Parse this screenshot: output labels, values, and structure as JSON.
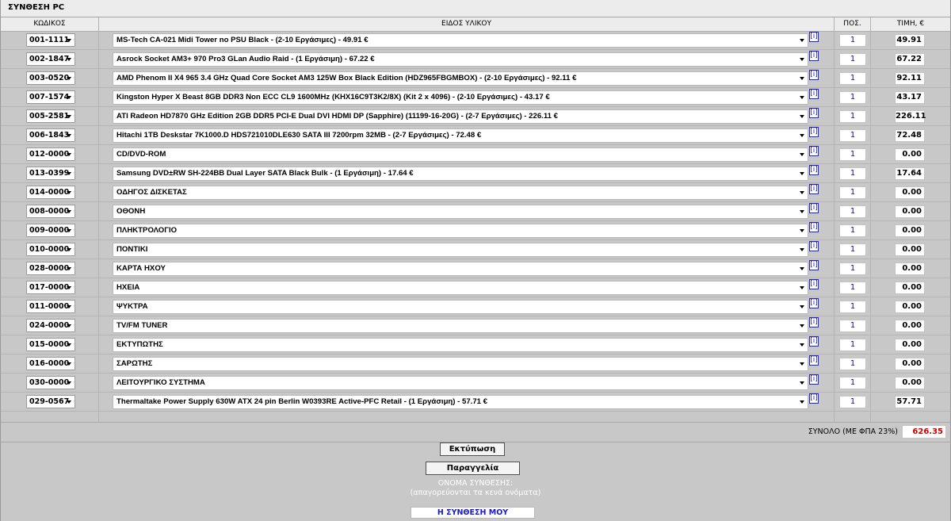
{
  "window": {
    "title": "ΣΥΝΘΕΣΗ PC"
  },
  "columns": {
    "code": "ΚΩΔΙΚΟΣ",
    "item": "ΕΙΔΟΣ ΥΛΙΚΟΥ",
    "qty": "ΠΟΣ.",
    "price": "ΤΙΜΗ, €"
  },
  "info_glyph": "[i]",
  "rows": [
    {
      "code": "001-1111",
      "desc": "MS-Tech CA-021 Midi Tower no PSU Black - (2-10 Εργάσιμες) - 49.91 €",
      "qty": "1",
      "price": "49.91"
    },
    {
      "code": "002-1847",
      "desc": "Asrock Socket AM3+ 970 Pro3 GLan Audio Raid - (1 Εργάσιμη) - 67.22 €",
      "qty": "1",
      "price": "67.22"
    },
    {
      "code": "003-0520",
      "desc": "AMD Phenom II X4 965 3.4 GHz Quad Core Socket AM3 125W Box Black Edition (HDZ965FBGMBOX) - (2-10 Εργάσιμες) - 92.11 €",
      "qty": "1",
      "price": "92.11"
    },
    {
      "code": "007-1574",
      "desc": "Kingston Hyper X Beast 8GB DDR3 Non ECC CL9 1600MHz (KHX16C9T3K2/8X) (Kit 2 x 4096) - (2-10 Εργάσιμες) - 43.17 €",
      "qty": "1",
      "price": "43.17"
    },
    {
      "code": "005-2581",
      "desc": "ATI Radeon HD7870 GHz Edition 2GB DDR5 PCI-E Dual DVI HDMI DP (Sapphire) (11199-16-20G) - (2-7 Εργάσιμες) - 226.11 €",
      "qty": "1",
      "price": "226.11"
    },
    {
      "code": "006-1843",
      "desc": "Hitachi 1TB Deskstar 7K1000.D HDS721010DLE630 SATA III 7200rpm 32MB - (2-7 Εργάσιμες) - 72.48 €",
      "qty": "1",
      "price": "72.48"
    },
    {
      "code": "012-0000",
      "desc": "CD/DVD-ROM",
      "qty": "1",
      "price": "0.00"
    },
    {
      "code": "013-0399",
      "desc": "Samsung DVD±RW SH-224BB Dual Layer SATA Black Bulk - (1 Εργάσιμη) - 17.64 €",
      "qty": "1",
      "price": "17.64"
    },
    {
      "code": "014-0000",
      "desc": "ΟΔΗΓΟΣ ΔΙΣΚΕΤΑΣ",
      "qty": "1",
      "price": "0.00"
    },
    {
      "code": "008-0000",
      "desc": "ΟΘΟΝΗ",
      "qty": "1",
      "price": "0.00"
    },
    {
      "code": "009-0000",
      "desc": "ΠΛΗΚΤΡΟΛΟΓΙΟ",
      "qty": "1",
      "price": "0.00"
    },
    {
      "code": "010-0000",
      "desc": "ΠΟΝΤΙΚΙ",
      "qty": "1",
      "price": "0.00"
    },
    {
      "code": "028-0000",
      "desc": "ΚΑΡΤΑ ΗΧΟΥ",
      "qty": "1",
      "price": "0.00"
    },
    {
      "code": "017-0000",
      "desc": "ΗΧΕΙΑ",
      "qty": "1",
      "price": "0.00"
    },
    {
      "code": "011-0000",
      "desc": "ΨΥΚΤΡΑ",
      "qty": "1",
      "price": "0.00"
    },
    {
      "code": "024-0000",
      "desc": "TV/FM TUNER",
      "qty": "1",
      "price": "0.00"
    },
    {
      "code": "015-0000",
      "desc": "ΕΚΤΥΠΩΤΗΣ",
      "qty": "1",
      "price": "0.00"
    },
    {
      "code": "016-0000",
      "desc": "ΣΑΡΩΤΗΣ",
      "qty": "1",
      "price": "0.00"
    },
    {
      "code": "030-0000",
      "desc": "ΛΕΙΤΟΥΡΓΙΚΟ ΣΥΣΤΗΜΑ",
      "qty": "1",
      "price": "0.00"
    },
    {
      "code": "029-0567",
      "desc": "Thermaltake Power Supply 630W ATX 24 pin Berlin W0393RE Active-PFC Retail - (1 Εργάσιμη) - 57.71 €",
      "qty": "1",
      "price": "57.71"
    }
  ],
  "total": {
    "label": "ΣΥΝΟΛΟ (ΜΕ ΦΠΑ 23%)",
    "value": "626.35"
  },
  "actions": {
    "print": "Εκτύπωση",
    "order": "Παραγγελία"
  },
  "name_section": {
    "label": "ΟΝΟΜΑ ΣΥΝΘΕΣΗΣ:",
    "hint": "(απαγορεύονται τα κενά ονόματα)",
    "value": "Η ΣΥΝΘΕΣΗ ΜΟΥ"
  },
  "colors": {
    "total_value": "#cc0000",
    "info_link": "#2222cc",
    "name_value": "#1a1acc"
  }
}
